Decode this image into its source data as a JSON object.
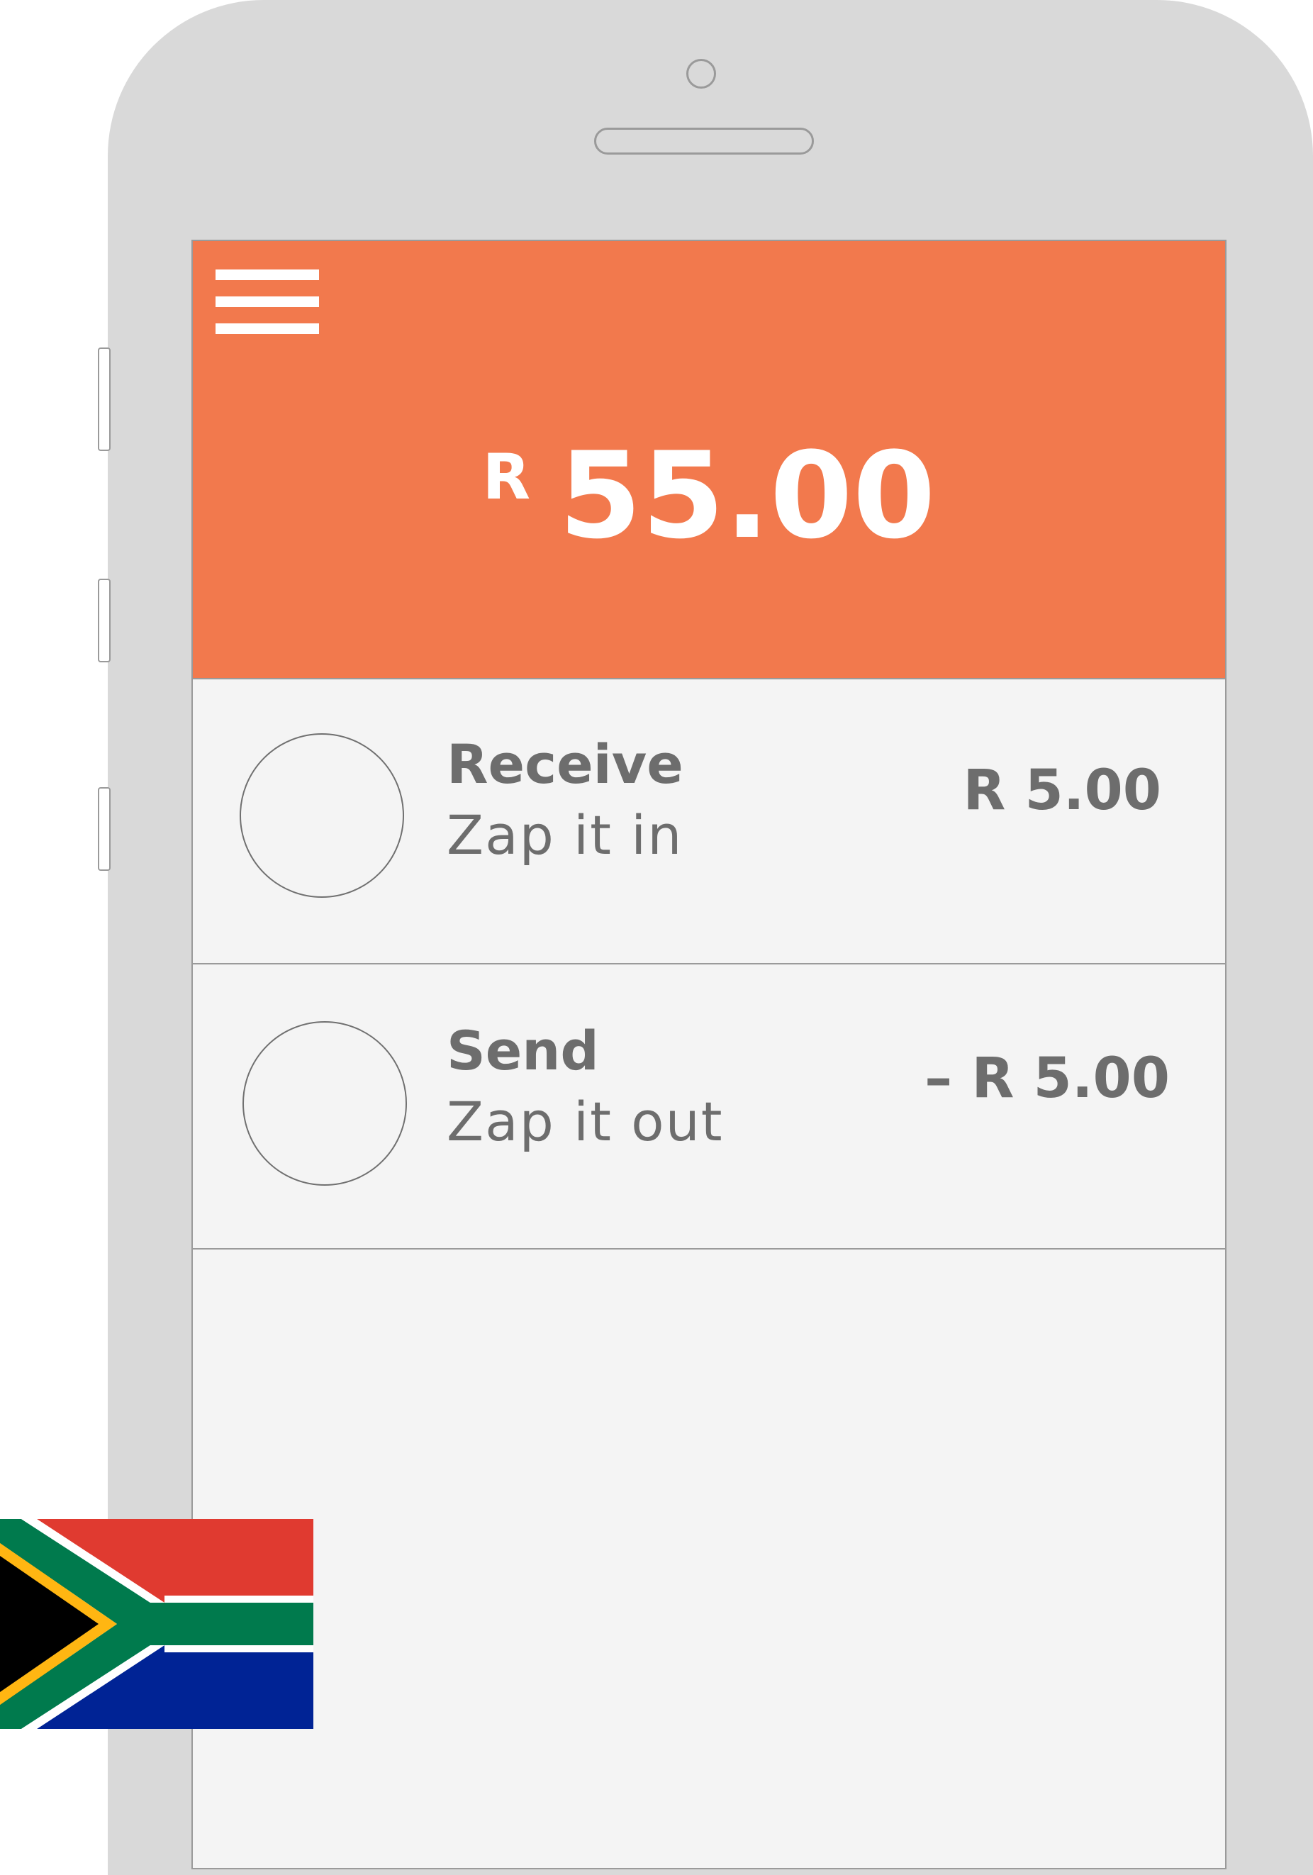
{
  "header": {
    "balance_currency": "R",
    "balance_amount": "55.00"
  },
  "transactions": [
    {
      "title": "Receive",
      "subtitle": "Zap it in",
      "amount": "R 5.00"
    },
    {
      "title": "Send",
      "subtitle": "Zap it out",
      "amount": "– R 5.00"
    }
  ],
  "colors": {
    "header_background": "#f2794d",
    "screen_background": "#f4f4f4",
    "phone_body": "#d9d9d9",
    "text_gray": "#6d6d6d"
  },
  "icons": {
    "menu": "hamburger-menu-icon",
    "flag": "south-africa-flag"
  }
}
